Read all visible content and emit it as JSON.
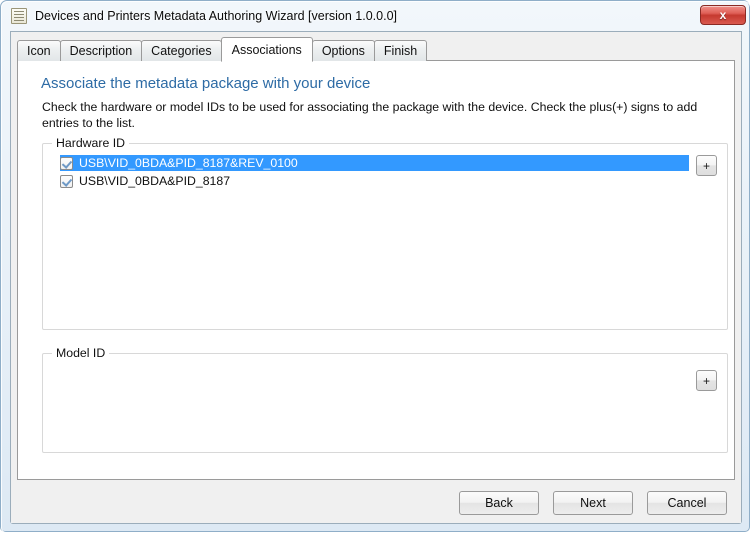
{
  "window": {
    "title": "Devices and Printers Metadata Authoring Wizard [version 1.0.0.0]",
    "icon": "document-icon",
    "close_label": "x",
    "accent_selection_color": "#3399ff",
    "heading_color": "#2d6ba5"
  },
  "tabs": [
    {
      "label": "Icon",
      "selected": false
    },
    {
      "label": "Description",
      "selected": false
    },
    {
      "label": "Categories",
      "selected": false
    },
    {
      "label": "Associations",
      "selected": true
    },
    {
      "label": "Options",
      "selected": false
    },
    {
      "label": "Finish",
      "selected": false
    }
  ],
  "page": {
    "heading": "Associate the metadata package with your device",
    "description": "Check the hardware or model IDs to be used for associating the package with the device. Check the plus(+) signs to add entries to the list."
  },
  "hardware_id": {
    "group_label": "Hardware ID",
    "add_button_label": "+",
    "items": [
      {
        "label": "USB\\VID_0BDA&PID_8187&REV_0100",
        "checked": true,
        "selected": true
      },
      {
        "label": "USB\\VID_0BDA&PID_8187",
        "checked": true,
        "selected": false
      }
    ]
  },
  "model_id": {
    "group_label": "Model ID",
    "add_button_label": "+",
    "items": []
  },
  "footer": {
    "back_label": "Back",
    "next_label": "Next",
    "cancel_label": "Cancel"
  }
}
